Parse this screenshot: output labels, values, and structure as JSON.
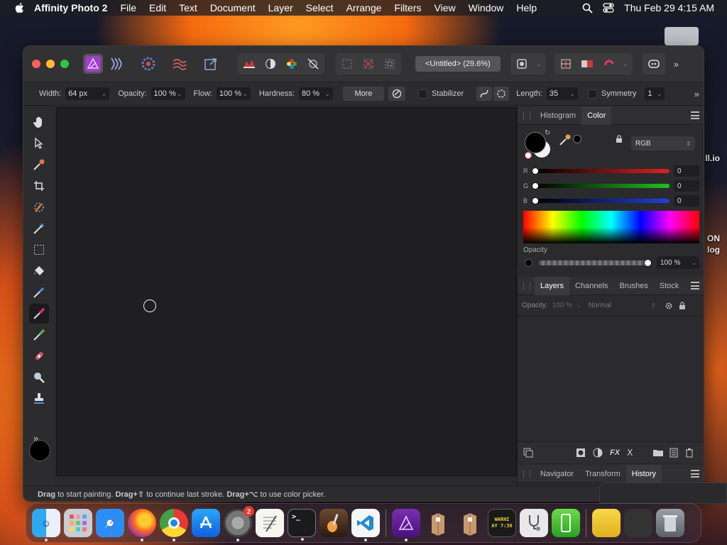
{
  "menubar": {
    "app_name": "Affinity Photo 2",
    "items": [
      "File",
      "Edit",
      "Text",
      "Document",
      "Layer",
      "Select",
      "Arrange",
      "Filters",
      "View",
      "Window",
      "Help"
    ],
    "clock": "Thu Feb 29  4:15 AM"
  },
  "desktop": {
    "label1": "ll.io",
    "label2": "ON",
    "label3": "log"
  },
  "document": {
    "title": "<Untitled> (29.6%)"
  },
  "context": {
    "width_label": "Width:",
    "width_value": "64 px",
    "opacity_label": "Opacity:",
    "opacity_value": "100 %",
    "flow_label": "Flow:",
    "flow_value": "100 %",
    "hardness_label": "Hardness:",
    "hardness_value": "80 %",
    "more": "More",
    "stabilizer": "Stabilizer",
    "length_label": "Length:",
    "length_value": "35",
    "symmetry": "Symmetry",
    "symmetry_value": "1"
  },
  "color_panel": {
    "tabs": [
      "Histogram",
      "Color"
    ],
    "model": "RGB",
    "r_label": "R",
    "r_value": "0",
    "g_label": "G",
    "g_value": "0",
    "b_label": "B",
    "b_value": "0",
    "opacity_label": "Opacity",
    "opacity_value": "100 %"
  },
  "layers_panel": {
    "tabs": [
      "Layers",
      "Channels",
      "Brushes",
      "Stock"
    ],
    "opacity_label": "Opacity:",
    "opacity_value": "100 %",
    "blend_mode": "Normal"
  },
  "history_panel": {
    "tabs": [
      "Navigator",
      "Transform",
      "History"
    ]
  },
  "status": {
    "drag1": "Drag",
    "text1": " to start painting. ",
    "drag2": "Drag+⇧",
    "text2": " to continue last stroke. ",
    "drag3": "Drag+⌥",
    "text3": " to use color picker."
  },
  "dock": {
    "settings_badge": "2",
    "console_text": "WARNI\nAY 7:36"
  },
  "colors": {
    "accent": "#c039e0",
    "window_bg": "#2a2a2c",
    "canvas": "#1f1f21"
  }
}
